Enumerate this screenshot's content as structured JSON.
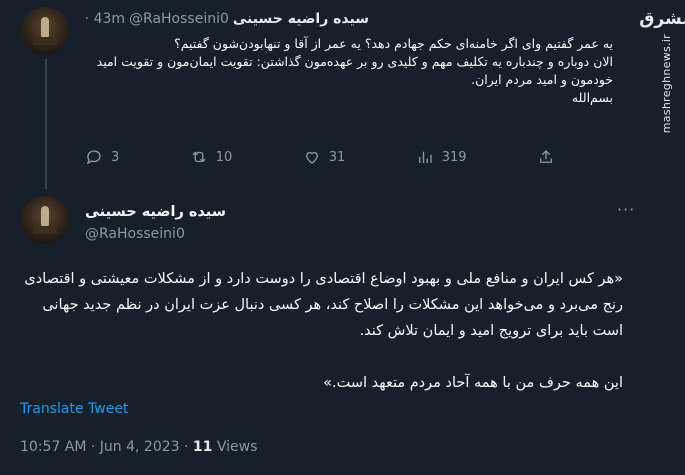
{
  "watermark": {
    "logo": "مشرق",
    "url": "mashreghnews.ir"
  },
  "tweet1": {
    "display_name": "سیده راضیه حسینی",
    "handle": "@RaHosseini0",
    "time": "· 43m",
    "lines": [
      "یه عمر گفتیم وای اگر خامنه‌ای حکم جهادم دهد؟ یه عمر از آقا و تنهابودن‌شون گفتیم؟",
      "الان دوباره و چندباره یه تکلیف مهم و کلیدی رو بر عهده‌مون گذاشتن: تقویت ایمان‌مون و تقویت امید",
      "خودمون و امید مردم ایران.",
      "بسم‌الله"
    ],
    "actions": {
      "replies": "3",
      "retweets": "10",
      "likes": "31",
      "views": "319"
    },
    "icons": [
      "reply-icon",
      "retweet-icon",
      "like-icon",
      "views-icon",
      "share-icon"
    ]
  },
  "tweet2": {
    "display_name": "سیده راضیه حسینی",
    "handle": "@RaHosseini0",
    "more": "···",
    "paragraph1": "«هر کس ایران و منافع ملی و بهبود اوضاع اقتصادی را دوست دارد و از مشکلات معیشتی و اقتصادی رنج می‌برد و می‌خواهد این مشکلات را اصلاح کند، هر کسی دنبال عزت ایران در نظم جدید جهانی است باید برای ترویج امید و ایمان تلاش کند.",
    "paragraph2": "این همه حرف من با همه آحاد مردم متعهد است.»",
    "translate": "Translate Tweet",
    "timestamp": "10:57 AM · Jun 4, 2023 ·",
    "views_count": "11",
    "views_label": "Views"
  }
}
